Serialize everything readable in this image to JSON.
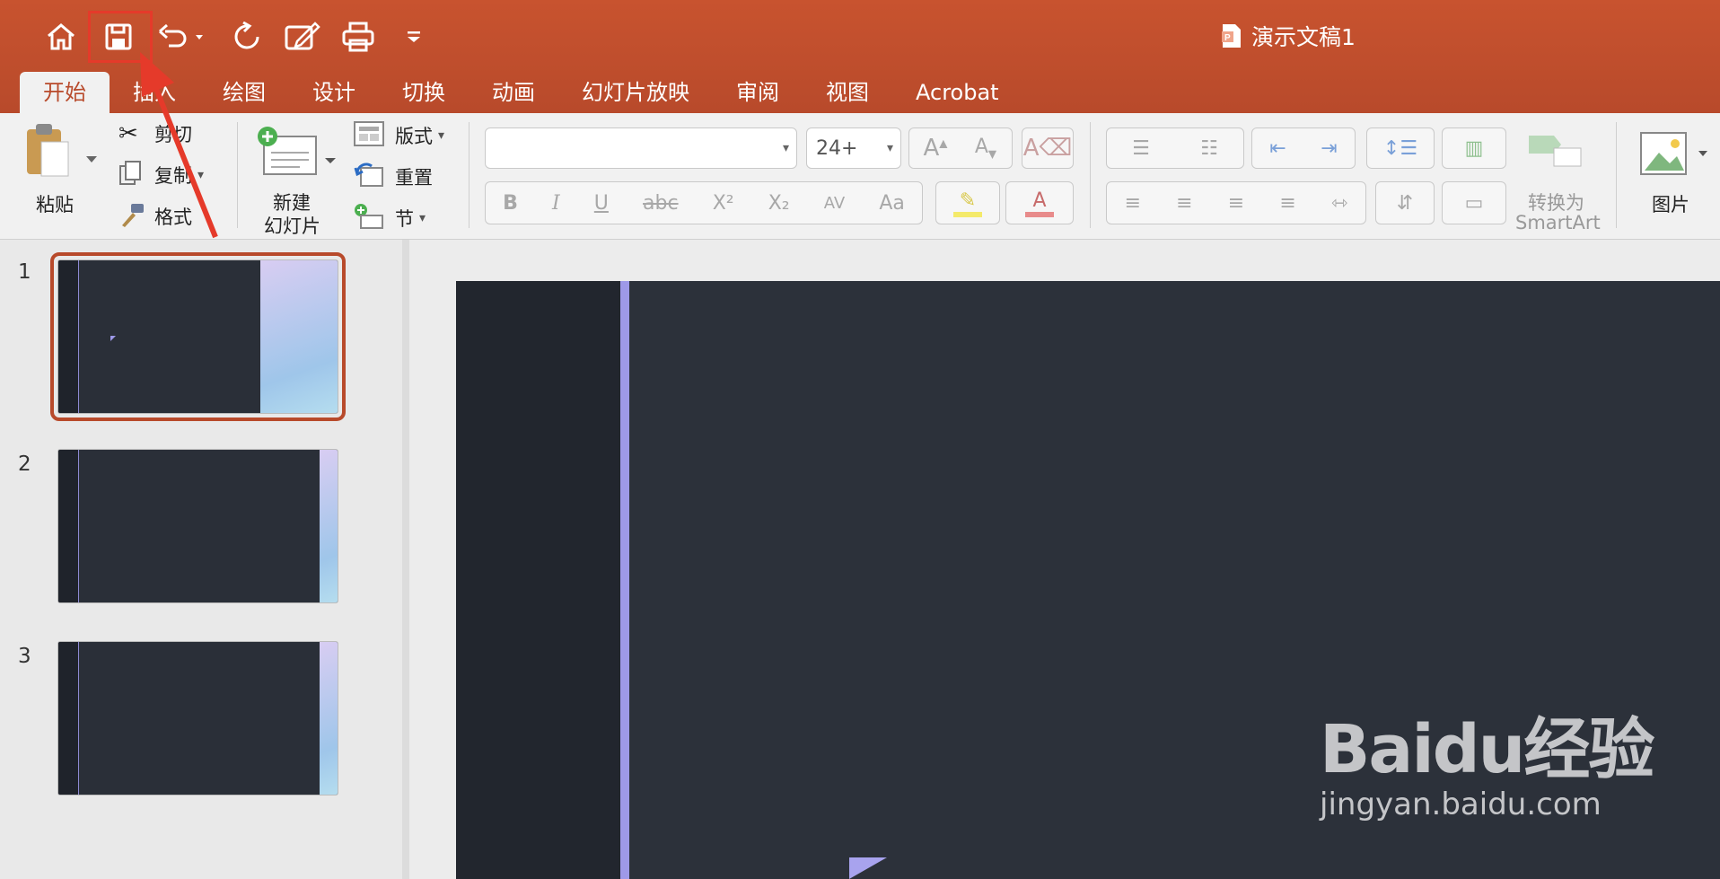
{
  "window": {
    "title": "演示文稿1"
  },
  "tabs": [
    "开始",
    "插入",
    "绘图",
    "设计",
    "切换",
    "动画",
    "幻灯片放映",
    "审阅",
    "视图",
    "Acrobat"
  ],
  "active_tab": "开始",
  "ribbon": {
    "paste": "粘贴",
    "cut": "剪切",
    "copy": "复制",
    "format_painter": "格式",
    "new_slide_line1": "新建",
    "new_slide_line2": "幻灯片",
    "layout": "版式",
    "reset": "重置",
    "section": "节",
    "font_name": "",
    "font_size": "24+",
    "convert_smartart_line1": "转换为",
    "convert_smartart_line2": "SmartArt",
    "picture": "图片"
  },
  "format_buttons": {
    "bold": "B",
    "italic": "I",
    "underline": "U",
    "strike": "abc",
    "superscript": "X²",
    "subscript": "X₂",
    "spacing": "AV",
    "case": "Aa",
    "font_color": "A",
    "grow": "A",
    "shrink": "A"
  },
  "slides": [
    {
      "number": "1",
      "selected": true
    },
    {
      "number": "2",
      "selected": false
    },
    {
      "number": "3",
      "selected": false
    }
  ],
  "watermark": {
    "brand": "Baidu经验",
    "url": "jingyan.baidu.com"
  },
  "colors": {
    "title_bar": "#b84a2b",
    "annotation": "#e53a2a",
    "accent_stripe": "#9e99e8",
    "slide_bg": "#2c313a"
  }
}
